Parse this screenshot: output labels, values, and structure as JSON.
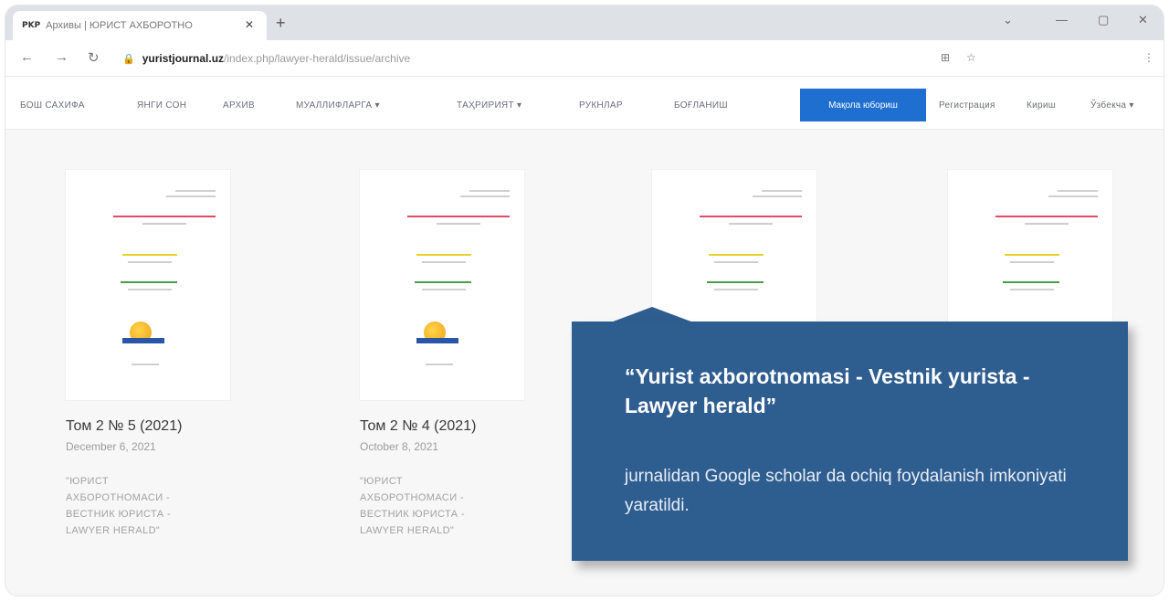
{
  "browser": {
    "tab_favicon": "PKP",
    "tab_title": "Архивы | ЮРИСТ АХБОРОТНО",
    "tab_close": "✕",
    "new_tab": "+",
    "url_host": "yuristjournal.uz",
    "url_path": "/index.php/lawyer-herald/issue/archive"
  },
  "nav": {
    "items": [
      "БОШ САХИФА",
      "ЯНГИ СОН",
      "АРХИВ",
      "МУАЛЛИФЛАРГА ▾",
      "ТАҲРИРИЯТ ▾",
      "РУКНЛАР",
      "БОҒЛАНИШ"
    ],
    "submit": "Мақола юбориш",
    "register": "Регистрация",
    "login": "Кириш",
    "language": "Ўзбекча ▾"
  },
  "issues": [
    {
      "title": "Том 2 № 5 (2021)",
      "date": "December 6, 2021",
      "desc": "\"ЮРИСТ АХБОРОТНОМАСИ - ВЕСТНИК ЮРИСТА - LAWYER HERALD\""
    },
    {
      "title": "Том 2 № 4 (2021)",
      "date": "October 8, 2021",
      "desc": "\"ЮРИСТ АХБОРОТНОМАСИ - ВЕСТНИК ЮРИСТА - LAWYER HERALD\""
    }
  ],
  "callout": {
    "heading": "“Yurist axborotnomasi - Vestnik yurista - Lawyer herald”",
    "body": "jurnalidan Google scholar da ochiq foydalanish imkoniyati yaratildi."
  },
  "colors": {
    "accent": "#1f6fd0",
    "callout_bg": "#2e5d8f"
  }
}
